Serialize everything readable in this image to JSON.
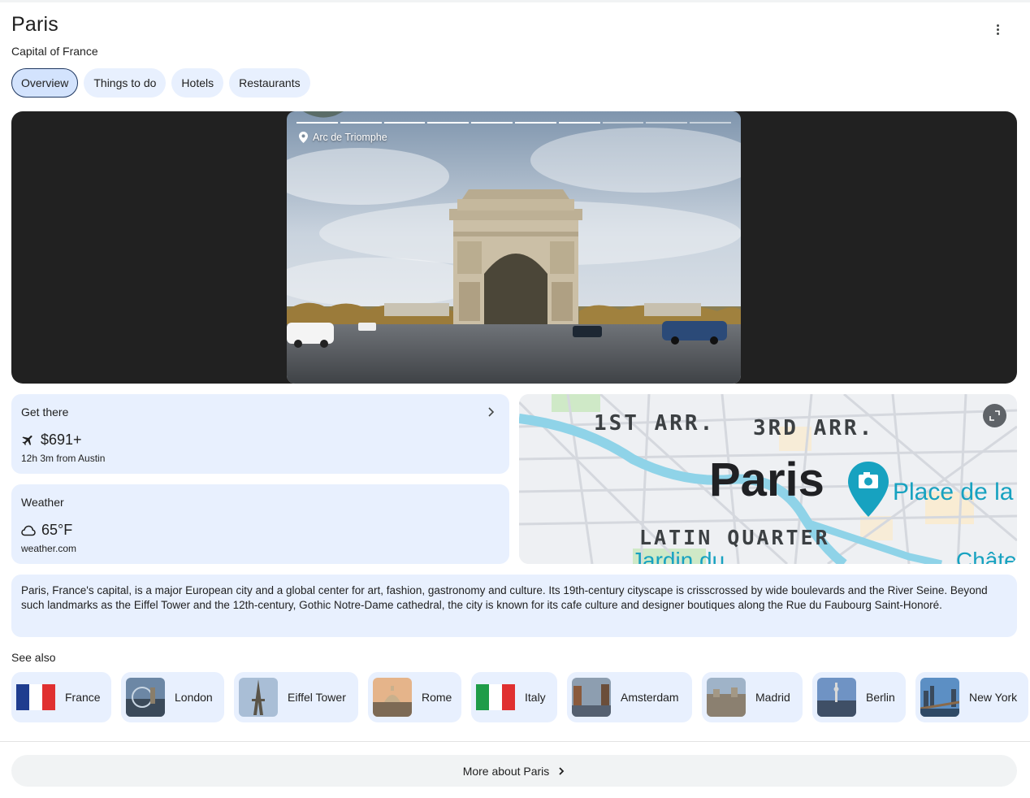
{
  "header": {
    "title": "Paris",
    "subtitle": "Capital of France"
  },
  "tabs": [
    {
      "label": "Overview",
      "active": true
    },
    {
      "label": "Things to do",
      "active": false
    },
    {
      "label": "Hotels",
      "active": false
    },
    {
      "label": "Restaurants",
      "active": false
    }
  ],
  "media": {
    "location_label": "Arc de Triomphe",
    "slides_total": 10,
    "slides_viewed": 7
  },
  "get_there": {
    "title": "Get there",
    "price": "$691+",
    "detail": "12h 3m from Austin",
    "icon": "airplane-icon"
  },
  "weather": {
    "title": "Weather",
    "temperature": "65°F",
    "source": "weather.com",
    "icon": "cloud-icon"
  },
  "map": {
    "labels": [
      "1ST ARR.",
      "3RD ARR.",
      "Paris",
      "Place de la",
      "LATIN QUARTER",
      "Jardin du",
      "Châte"
    ]
  },
  "description": "Paris, France's capital, is a major European city and a global center for art, fashion, gastronomy and culture. Its 19th-century cityscape is crisscrossed by wide boulevards and the River Seine. Beyond such landmarks as the Eiffel Tower and the 12th-century, Gothic Notre-Dame cathedral, the city is known for its cafe culture and designer boutiques along the Rue du Faubourg Saint-Honoré.",
  "see_also": {
    "label": "See also",
    "items": [
      {
        "label": "France",
        "thumb": "france-flag"
      },
      {
        "label": "London",
        "thumb": "london-photo"
      },
      {
        "label": "Eiffel Tower",
        "thumb": "eiffel-tower-photo"
      },
      {
        "label": "Rome",
        "thumb": "rome-photo"
      },
      {
        "label": "Italy",
        "thumb": "italy-flag"
      },
      {
        "label": "Amsterdam",
        "thumb": "amsterdam-photo"
      },
      {
        "label": "Madrid",
        "thumb": "madrid-photo"
      },
      {
        "label": "Berlin",
        "thumb": "berlin-photo"
      },
      {
        "label": "New York",
        "thumb": "new-york-photo"
      }
    ]
  },
  "footer": {
    "more_label": "More about Paris"
  },
  "colors": {
    "card_bg": "#e8f0fe",
    "active_chip_bg": "#d3e3fd",
    "media_bg": "#212121",
    "water": "#8fd3e8",
    "map_pin": "#17a2c0"
  }
}
